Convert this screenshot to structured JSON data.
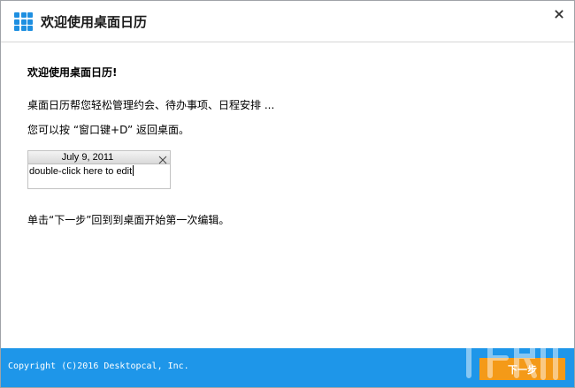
{
  "window": {
    "title": "欢迎使用桌面日历",
    "close_icon": "close-icon"
  },
  "content": {
    "heading": "欢迎使用桌面日历!",
    "line1": "桌面日历帮您轻松管理约会、待办事项、日程安排 ...",
    "line2": "您可以按 “窗口键+D” 返回桌面。",
    "line3": "单击“下一步”回到到桌面开始第一次编辑。"
  },
  "widget": {
    "date": "July 9, 2011",
    "body_text": "double-click here to edit"
  },
  "footer": {
    "copyright": "Copyright (C)2016 Desktopcal, Inc.",
    "next_label": "下一步"
  },
  "colors": {
    "accent": "#1e96e9",
    "logo": "#1e8fe1",
    "next_button": "#f49a18"
  }
}
